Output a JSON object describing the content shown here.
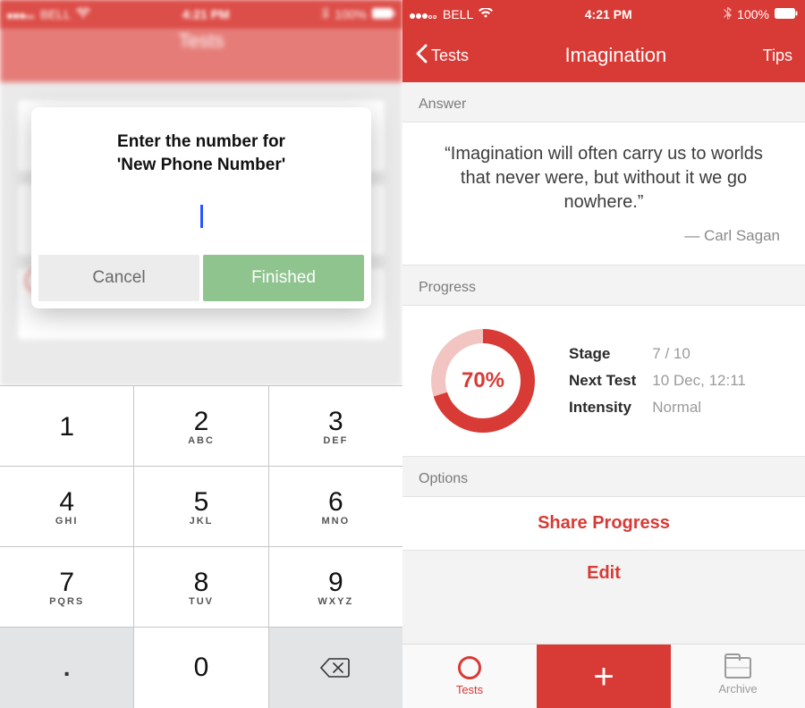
{
  "status": {
    "carrier": "BELL",
    "time": "4:21 PM",
    "battery": "100%"
  },
  "left": {
    "blurred_title": "Tests",
    "modal": {
      "title": "Enter the number for\n'New Phone Number'",
      "cancel_label": "Cancel",
      "finish_label": "Finished",
      "input_value": ""
    },
    "keypad": [
      {
        "num": "1",
        "letters": ""
      },
      {
        "num": "2",
        "letters": "ABC"
      },
      {
        "num": "3",
        "letters": "DEF"
      },
      {
        "num": "4",
        "letters": "GHI"
      },
      {
        "num": "5",
        "letters": "JKL"
      },
      {
        "num": "6",
        "letters": "MNO"
      },
      {
        "num": "7",
        "letters": "PQRS"
      },
      {
        "num": "8",
        "letters": "TUV"
      },
      {
        "num": "9",
        "letters": "WXYZ"
      },
      {
        "num": ".",
        "letters": ""
      },
      {
        "num": "0",
        "letters": ""
      },
      {
        "num": "⌫",
        "letters": ""
      }
    ]
  },
  "right": {
    "nav": {
      "back": "Tests",
      "title": "Imagination",
      "right": "Tips"
    },
    "answer": {
      "header": "Answer",
      "quote": "“Imagination will often carry us to worlds that never were, but without it we go nowhere.”",
      "author": "— Carl Sagan"
    },
    "progress": {
      "header": "Progress",
      "percent_label": "70%",
      "percent": 70,
      "rows": {
        "stage_label": "Stage",
        "stage_value": "7 / 10",
        "next_label": "Next Test",
        "next_value": "10 Dec, 12:11",
        "intensity_label": "Intensity",
        "intensity_value": "Normal"
      }
    },
    "options": {
      "header": "Options",
      "share": "Share Progress",
      "peek": "Edit"
    },
    "tabs": {
      "tests": "Tests",
      "archive": "Archive"
    }
  }
}
